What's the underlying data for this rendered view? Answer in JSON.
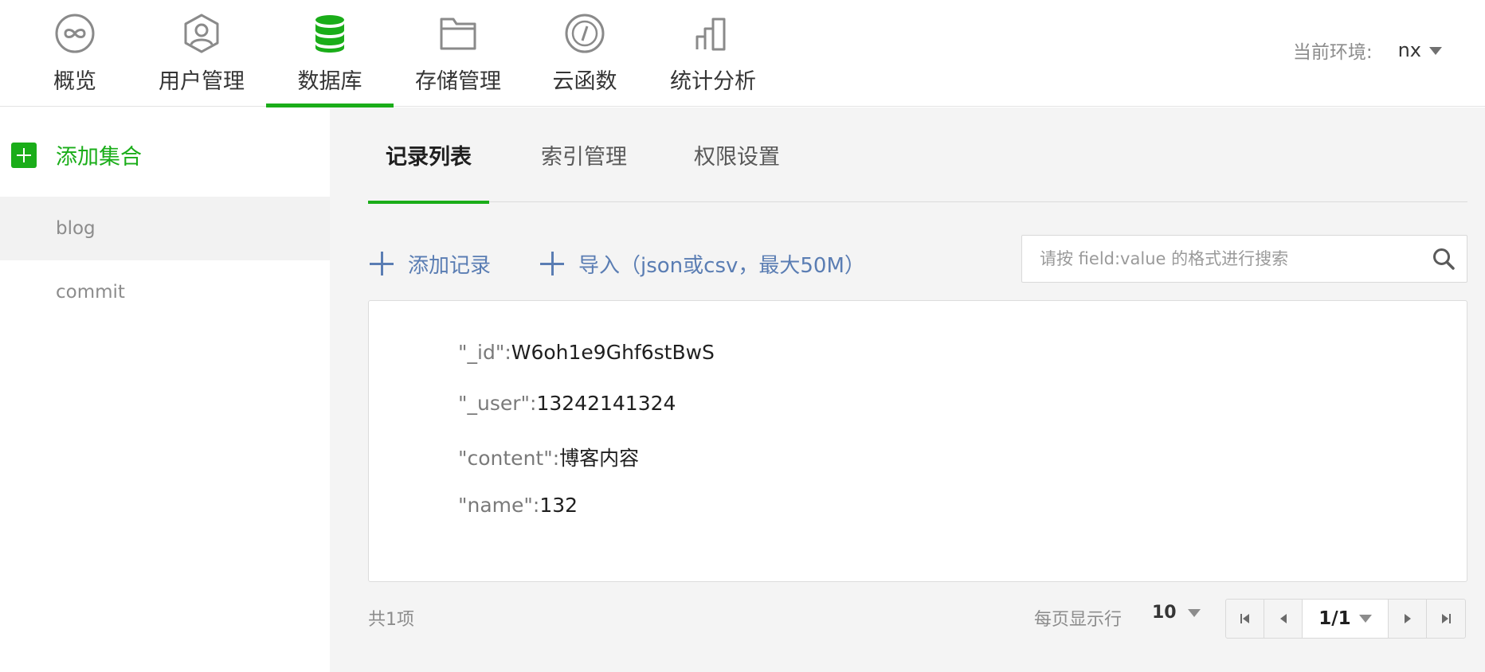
{
  "nav": {
    "items": [
      {
        "label": "概览",
        "icon": "infinity-icon"
      },
      {
        "label": "用户管理",
        "icon": "user-icon"
      },
      {
        "label": "数据库",
        "icon": "database-icon",
        "active": true
      },
      {
        "label": "存储管理",
        "icon": "folder-icon"
      },
      {
        "label": "云函数",
        "icon": "function-code-icon"
      },
      {
        "label": "统计分析",
        "icon": "stats-icon"
      }
    ],
    "env_label": "当前环境:",
    "env_value": "nx"
  },
  "sidebar": {
    "add_label": "添加集合",
    "collections": [
      {
        "name": "blog",
        "selected": true
      },
      {
        "name": "commit",
        "selected": false
      }
    ]
  },
  "main": {
    "tabs": [
      {
        "label": "记录列表",
        "active": true
      },
      {
        "label": "索引管理",
        "active": false
      },
      {
        "label": "权限设置",
        "active": false
      }
    ],
    "add_record_label": "添加记录",
    "import_label": "导入（json或csv，最大50M）",
    "search_placeholder": "请按 field:value 的格式进行搜索",
    "record": [
      {
        "key": "\"_id\":",
        "value": "W6oh1e9Ghf6stBwS"
      },
      {
        "key": "\"_user\":",
        "value": "13242141324"
      },
      {
        "key": "\"content\":",
        "value": "博客内容"
      },
      {
        "key": "\"name\":",
        "value": "132"
      }
    ],
    "total_label": "共1项",
    "perpage_label": "每页显示行",
    "perpage_value": "10",
    "page_indicator": "1/1"
  },
  "colors": {
    "accent": "#1aad19",
    "link": "#5a7db3",
    "background": "#f4f4f4"
  }
}
